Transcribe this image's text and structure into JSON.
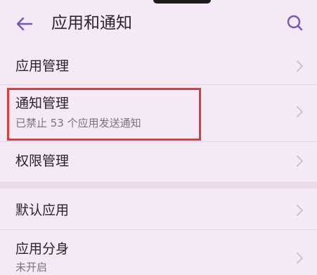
{
  "header": {
    "title": "应用和通知",
    "back_icon": "arrow-left-icon",
    "search_icon": "search-icon",
    "accent_color": "#7b55b8"
  },
  "rows": [
    {
      "title": "应用管理",
      "subtitle": null
    },
    {
      "title": "通知管理",
      "subtitle": "已禁止 53 个应用发送通知",
      "highlighted": true
    },
    {
      "title": "权限管理",
      "subtitle": null
    },
    {
      "title": "默认应用",
      "subtitle": null
    },
    {
      "title": "应用分身",
      "subtitle": "未开启"
    }
  ],
  "colors": {
    "background": "#f4e9f4",
    "highlight": "#e03a3a"
  }
}
